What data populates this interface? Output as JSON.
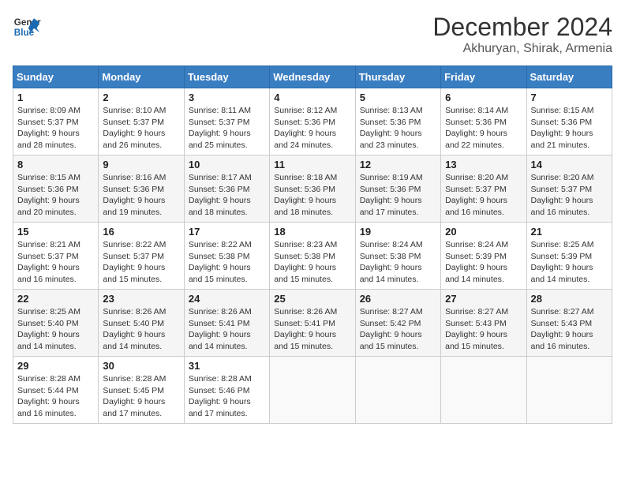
{
  "header": {
    "logo_line1": "General",
    "logo_line2": "Blue",
    "month": "December 2024",
    "location": "Akhuryan, Shirak, Armenia"
  },
  "days_of_week": [
    "Sunday",
    "Monday",
    "Tuesday",
    "Wednesday",
    "Thursday",
    "Friday",
    "Saturday"
  ],
  "weeks": [
    [
      {
        "day": "1",
        "info": "Sunrise: 8:09 AM\nSunset: 5:37 PM\nDaylight: 9 hours\nand 28 minutes."
      },
      {
        "day": "2",
        "info": "Sunrise: 8:10 AM\nSunset: 5:37 PM\nDaylight: 9 hours\nand 26 minutes."
      },
      {
        "day": "3",
        "info": "Sunrise: 8:11 AM\nSunset: 5:37 PM\nDaylight: 9 hours\nand 25 minutes."
      },
      {
        "day": "4",
        "info": "Sunrise: 8:12 AM\nSunset: 5:36 PM\nDaylight: 9 hours\nand 24 minutes."
      },
      {
        "day": "5",
        "info": "Sunrise: 8:13 AM\nSunset: 5:36 PM\nDaylight: 9 hours\nand 23 minutes."
      },
      {
        "day": "6",
        "info": "Sunrise: 8:14 AM\nSunset: 5:36 PM\nDaylight: 9 hours\nand 22 minutes."
      },
      {
        "day": "7",
        "info": "Sunrise: 8:15 AM\nSunset: 5:36 PM\nDaylight: 9 hours\nand 21 minutes."
      }
    ],
    [
      {
        "day": "8",
        "info": "Sunrise: 8:15 AM\nSunset: 5:36 PM\nDaylight: 9 hours\nand 20 minutes."
      },
      {
        "day": "9",
        "info": "Sunrise: 8:16 AM\nSunset: 5:36 PM\nDaylight: 9 hours\nand 19 minutes."
      },
      {
        "day": "10",
        "info": "Sunrise: 8:17 AM\nSunset: 5:36 PM\nDaylight: 9 hours\nand 18 minutes."
      },
      {
        "day": "11",
        "info": "Sunrise: 8:18 AM\nSunset: 5:36 PM\nDaylight: 9 hours\nand 18 minutes."
      },
      {
        "day": "12",
        "info": "Sunrise: 8:19 AM\nSunset: 5:36 PM\nDaylight: 9 hours\nand 17 minutes."
      },
      {
        "day": "13",
        "info": "Sunrise: 8:20 AM\nSunset: 5:37 PM\nDaylight: 9 hours\nand 16 minutes."
      },
      {
        "day": "14",
        "info": "Sunrise: 8:20 AM\nSunset: 5:37 PM\nDaylight: 9 hours\nand 16 minutes."
      }
    ],
    [
      {
        "day": "15",
        "info": "Sunrise: 8:21 AM\nSunset: 5:37 PM\nDaylight: 9 hours\nand 16 minutes."
      },
      {
        "day": "16",
        "info": "Sunrise: 8:22 AM\nSunset: 5:37 PM\nDaylight: 9 hours\nand 15 minutes."
      },
      {
        "day": "17",
        "info": "Sunrise: 8:22 AM\nSunset: 5:38 PM\nDaylight: 9 hours\nand 15 minutes."
      },
      {
        "day": "18",
        "info": "Sunrise: 8:23 AM\nSunset: 5:38 PM\nDaylight: 9 hours\nand 15 minutes."
      },
      {
        "day": "19",
        "info": "Sunrise: 8:24 AM\nSunset: 5:38 PM\nDaylight: 9 hours\nand 14 minutes."
      },
      {
        "day": "20",
        "info": "Sunrise: 8:24 AM\nSunset: 5:39 PM\nDaylight: 9 hours\nand 14 minutes."
      },
      {
        "day": "21",
        "info": "Sunrise: 8:25 AM\nSunset: 5:39 PM\nDaylight: 9 hours\nand 14 minutes."
      }
    ],
    [
      {
        "day": "22",
        "info": "Sunrise: 8:25 AM\nSunset: 5:40 PM\nDaylight: 9 hours\nand 14 minutes."
      },
      {
        "day": "23",
        "info": "Sunrise: 8:26 AM\nSunset: 5:40 PM\nDaylight: 9 hours\nand 14 minutes."
      },
      {
        "day": "24",
        "info": "Sunrise: 8:26 AM\nSunset: 5:41 PM\nDaylight: 9 hours\nand 14 minutes."
      },
      {
        "day": "25",
        "info": "Sunrise: 8:26 AM\nSunset: 5:41 PM\nDaylight: 9 hours\nand 15 minutes."
      },
      {
        "day": "26",
        "info": "Sunrise: 8:27 AM\nSunset: 5:42 PM\nDaylight: 9 hours\nand 15 minutes."
      },
      {
        "day": "27",
        "info": "Sunrise: 8:27 AM\nSunset: 5:43 PM\nDaylight: 9 hours\nand 15 minutes."
      },
      {
        "day": "28",
        "info": "Sunrise: 8:27 AM\nSunset: 5:43 PM\nDaylight: 9 hours\nand 16 minutes."
      }
    ],
    [
      {
        "day": "29",
        "info": "Sunrise: 8:28 AM\nSunset: 5:44 PM\nDaylight: 9 hours\nand 16 minutes."
      },
      {
        "day": "30",
        "info": "Sunrise: 8:28 AM\nSunset: 5:45 PM\nDaylight: 9 hours\nand 17 minutes."
      },
      {
        "day": "31",
        "info": "Sunrise: 8:28 AM\nSunset: 5:46 PM\nDaylight: 9 hours\nand 17 minutes."
      },
      null,
      null,
      null,
      null
    ]
  ]
}
